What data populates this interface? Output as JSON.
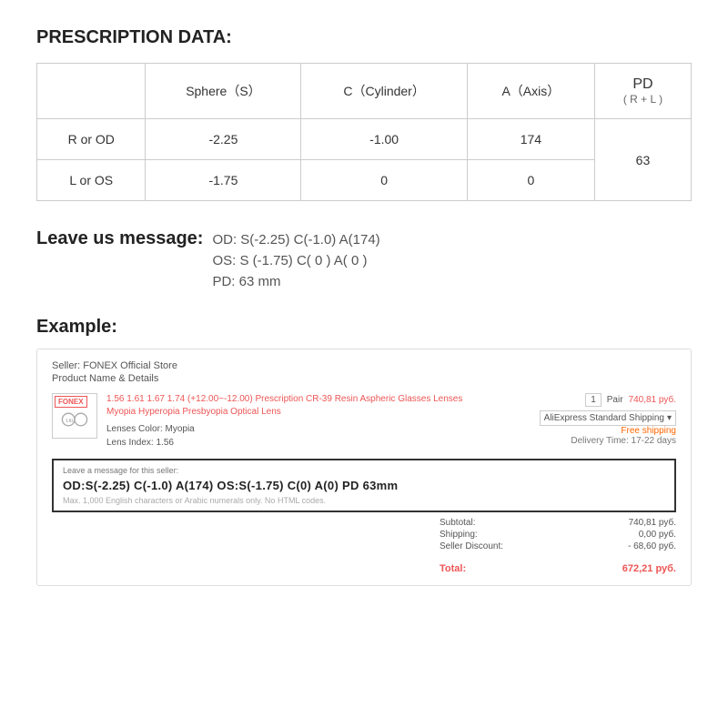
{
  "page": {
    "prescription_title": "PRESCRIPTION DATA:",
    "table": {
      "headers": {
        "empty": "",
        "sphere": "Sphere（S）",
        "cylinder": "C（Cylinder）",
        "axis": "A（Axis）",
        "pd_main": "PD",
        "pd_sub": "( R + L )"
      },
      "rows": [
        {
          "label": "R or OD",
          "sphere": "-2.25",
          "cylinder": "-1.00",
          "axis": "174"
        },
        {
          "label": "L or OS",
          "sphere": "-1.75",
          "cylinder": "0",
          "axis": "0"
        }
      ],
      "pd_value": "63"
    },
    "message_section": {
      "label": "Leave us message:",
      "lines": [
        "OD:  S(-2.25)    C(-1.0)   A(174)",
        "OS:  S (-1.75)    C( 0 )    A( 0 )",
        "PD:  63 mm"
      ]
    },
    "example_section": {
      "title": "Example:",
      "seller": "Seller: FONEX Official Store",
      "product_label": "Product Name & Details",
      "brand": "FONEX",
      "product_desc": "1.56 1.61 1.67 1.74 (+12.00~-12.00) Prescription CR-39 Resin Aspheric Glasses Lenses Myopia Hyperopia Presbyopia Optical Lens",
      "lenses_color_label": "Lenses Color:",
      "lenses_color_value": "Myopia",
      "lens_index_label": "Lens Index:",
      "lens_index_value": "1.56",
      "qty": "1",
      "qty_unit": "Pair",
      "price": "740,81 руб.",
      "shipping_option": "AliExpress Standard Shipping",
      "free_shipping": "Free shipping",
      "delivery": "Delivery Time: 17-22 days",
      "message_for_seller_label": "Leave a message for this seller:",
      "message_text": "OD:S(-2.25) C(-1.0) A(174)   OS:S(-1.75) C(0) A(0)   PD  63mm",
      "message_limit": "Max. 1,000 English characters or Arabic numerals only. No HTML codes.",
      "subtotal_label": "Subtotal:",
      "subtotal_value": "740,81 руб.",
      "shipping_label": "Shipping:",
      "shipping_value": "0,00 руб.",
      "discount_label": "Seller Discount:",
      "discount_value": "- 68,60 руб.",
      "total_label": "Total:",
      "total_value": "672,21 руб."
    }
  }
}
